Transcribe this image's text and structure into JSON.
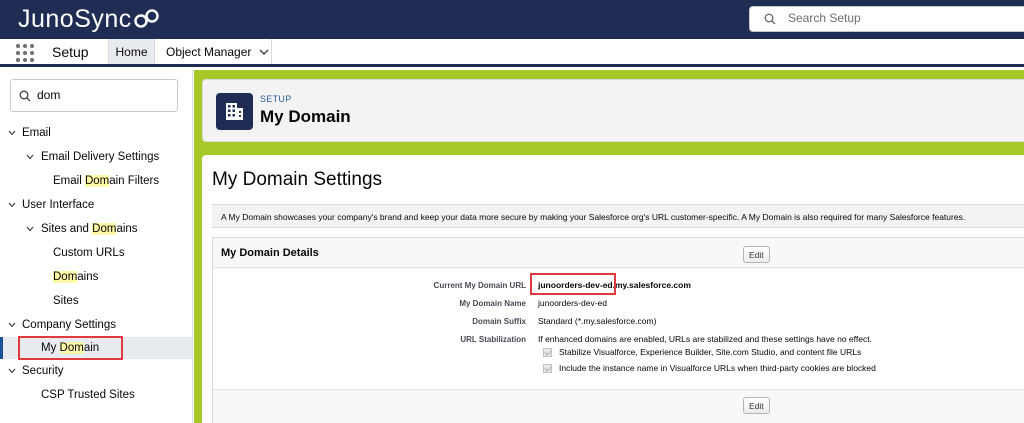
{
  "brand": {
    "logo_text": "JunoSync"
  },
  "search": {
    "placeholder": "Search Setup"
  },
  "nav": {
    "app_name": "Setup",
    "tabs": [
      {
        "label": "Home"
      },
      {
        "label": "Object Manager"
      }
    ]
  },
  "sidebar": {
    "quick_find_value": "dom",
    "items": [
      {
        "label": "Email"
      },
      {
        "label": "Email Delivery Settings"
      },
      {
        "pre": "Email ",
        "hl": "Dom",
        "post": "ain Filters"
      },
      {
        "label": "User Interface"
      },
      {
        "pre": "Sites and ",
        "hl": "Dom",
        "post": "ains"
      },
      {
        "label": "Custom URLs"
      },
      {
        "pre": "",
        "hl": "Dom",
        "post": "ains"
      },
      {
        "label": "Sites"
      },
      {
        "label": "Company Settings"
      },
      {
        "pre": "My ",
        "hl": "Dom",
        "post": "ain"
      },
      {
        "label": "Security"
      },
      {
        "label": "CSP Trusted Sites"
      }
    ]
  },
  "header": {
    "breadcrumb": "SETUP",
    "title": "My Domain"
  },
  "main": {
    "title": "My Domain Settings",
    "description": "A My Domain showcases your company's brand and keep your data more secure by making your Salesforce org's URL customer-specific. A My Domain is also required for many Salesforce features.",
    "section": {
      "title": "My Domain Details",
      "edit_label": "Edit",
      "fields": [
        {
          "label": "Current My Domain URL",
          "value_part1": "junoorders-dev-ed",
          "value_part2": ".my.salesforce.com"
        },
        {
          "label": "My Domain Name",
          "value": "junoorders-dev-ed"
        },
        {
          "label": "Domain Suffix",
          "value": "Standard (*.my.salesforce.com)"
        },
        {
          "label": "URL Stabilization",
          "value": "If enhanced domains are enabled, URLs are stabilized and these settings have no effect."
        }
      ],
      "checkboxes": [
        {
          "label": "Stabilize Visualforce, Experience Builder, Site.com Studio, and content file URLs",
          "checked": true
        },
        {
          "label": "Include the instance name in Visualforce URLs when third-party cookies are blocked",
          "checked": true
        }
      ]
    }
  },
  "colors": {
    "topbar": "#1f2d54",
    "accent_green": "#a6c929",
    "highlight": "#fdf9a7",
    "annotation_red": "#e0393e",
    "link_blue": "#2b5d9c"
  }
}
